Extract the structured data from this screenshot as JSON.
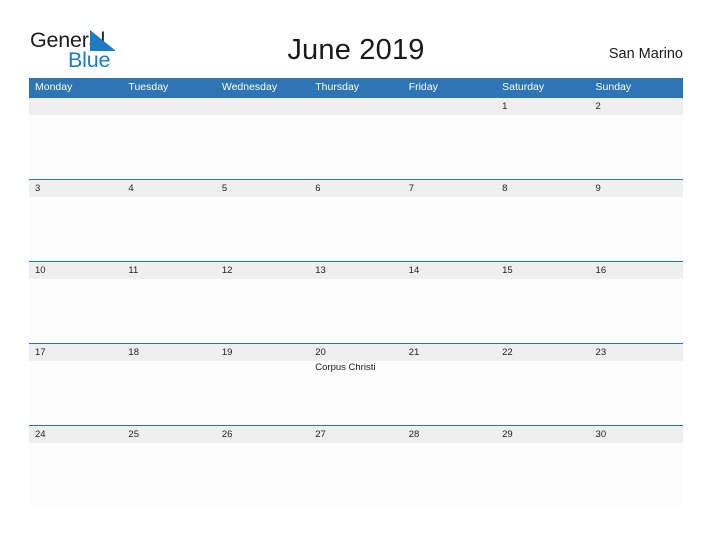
{
  "brand": {
    "name_part1": "General",
    "name_part2": "Blue",
    "accent_color": "#1e7bc4"
  },
  "header": {
    "title": "June 2019",
    "location": "San Marino",
    "header_bg_color": "#2e75b6",
    "number_band_color": "#efefef"
  },
  "weekdays": [
    "Monday",
    "Tuesday",
    "Wednesday",
    "Thursday",
    "Friday",
    "Saturday",
    "Sunday"
  ],
  "weeks": [
    {
      "days": [
        {
          "num": "",
          "event": ""
        },
        {
          "num": "",
          "event": ""
        },
        {
          "num": "",
          "event": ""
        },
        {
          "num": "",
          "event": ""
        },
        {
          "num": "",
          "event": ""
        },
        {
          "num": "1",
          "event": ""
        },
        {
          "num": "2",
          "event": ""
        }
      ]
    },
    {
      "days": [
        {
          "num": "3",
          "event": ""
        },
        {
          "num": "4",
          "event": ""
        },
        {
          "num": "5",
          "event": ""
        },
        {
          "num": "6",
          "event": ""
        },
        {
          "num": "7",
          "event": ""
        },
        {
          "num": "8",
          "event": ""
        },
        {
          "num": "9",
          "event": ""
        }
      ]
    },
    {
      "days": [
        {
          "num": "10",
          "event": ""
        },
        {
          "num": "11",
          "event": ""
        },
        {
          "num": "12",
          "event": ""
        },
        {
          "num": "13",
          "event": ""
        },
        {
          "num": "14",
          "event": ""
        },
        {
          "num": "15",
          "event": ""
        },
        {
          "num": "16",
          "event": ""
        }
      ]
    },
    {
      "days": [
        {
          "num": "17",
          "event": ""
        },
        {
          "num": "18",
          "event": ""
        },
        {
          "num": "19",
          "event": ""
        },
        {
          "num": "20",
          "event": "Corpus Christi"
        },
        {
          "num": "21",
          "event": ""
        },
        {
          "num": "22",
          "event": ""
        },
        {
          "num": "23",
          "event": ""
        }
      ]
    },
    {
      "days": [
        {
          "num": "24",
          "event": ""
        },
        {
          "num": "25",
          "event": ""
        },
        {
          "num": "26",
          "event": ""
        },
        {
          "num": "27",
          "event": ""
        },
        {
          "num": "28",
          "event": ""
        },
        {
          "num": "29",
          "event": ""
        },
        {
          "num": "30",
          "event": ""
        }
      ]
    }
  ]
}
